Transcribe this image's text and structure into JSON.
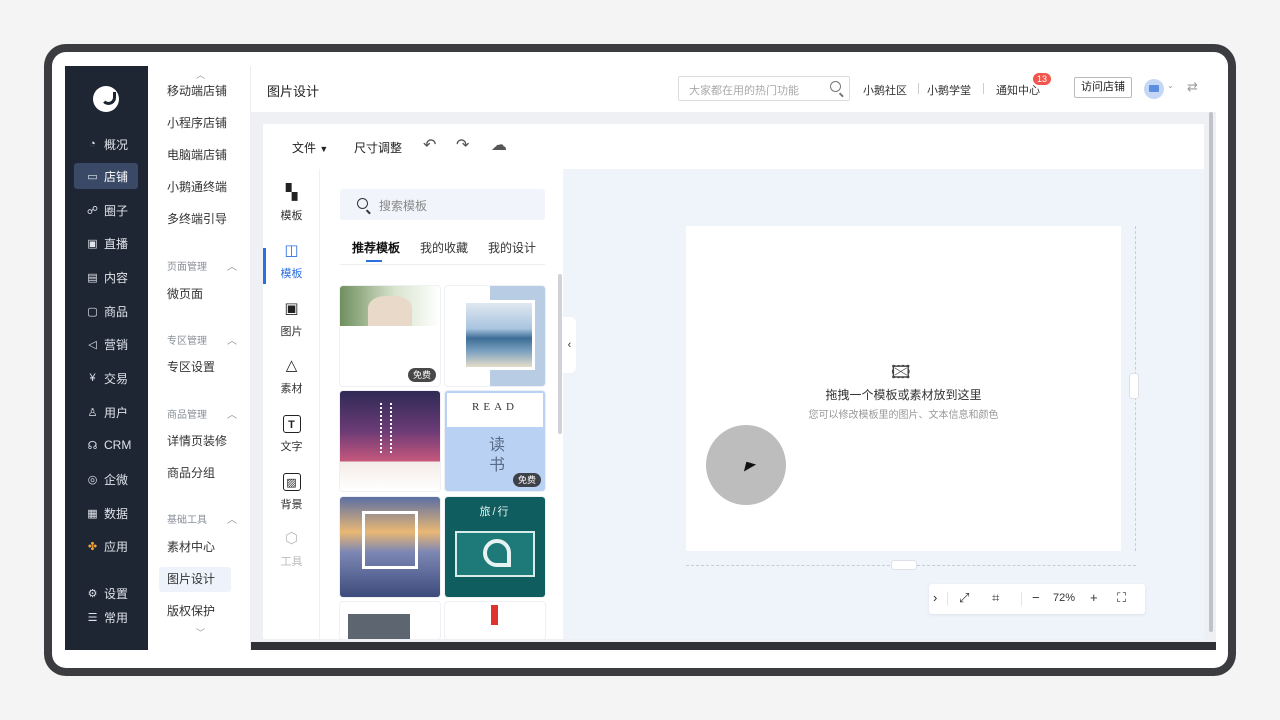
{
  "nav": {
    "items": [
      {
        "label": "概况",
        "icon": "chart-pie-icon"
      },
      {
        "label": "店铺",
        "icon": "store-icon",
        "active": true
      },
      {
        "label": "圈子",
        "icon": "users-icon"
      },
      {
        "label": "直播",
        "icon": "live-icon"
      },
      {
        "label": "内容",
        "icon": "document-icon"
      },
      {
        "label": "商品",
        "icon": "shopping-bag-icon"
      },
      {
        "label": "营销",
        "icon": "megaphone-icon"
      },
      {
        "label": "交易",
        "icon": "yen-icon"
      },
      {
        "label": "用户",
        "icon": "user-icon"
      },
      {
        "label": "CRM",
        "icon": "crm-icon"
      },
      {
        "label": "企微",
        "icon": "wecom-icon"
      },
      {
        "label": "数据",
        "icon": "dashboard-icon"
      },
      {
        "label": "应用",
        "icon": "apps-icon"
      },
      {
        "label": "设置",
        "icon": "gear-icon"
      },
      {
        "label": "常用",
        "icon": "list-icon"
      }
    ]
  },
  "submenu": {
    "items_top": [
      "移动端店铺",
      "小程序店铺",
      "电脑端店铺",
      "小鹅通终端",
      "多终端引导"
    ],
    "groups": [
      {
        "title": "页面管理",
        "items": [
          "微页面"
        ]
      },
      {
        "title": "专区管理",
        "items": [
          "专区设置"
        ]
      },
      {
        "title": "商品管理",
        "items": [
          "详情页装修",
          "商品分组"
        ]
      },
      {
        "title": "基础工具",
        "items": [
          "素材中心",
          "图片设计",
          "版权保护"
        ]
      }
    ],
    "active": "图片设计"
  },
  "header": {
    "title": "图片设计",
    "search_placeholder": "大家都在用的热门功能",
    "links": [
      "小鹅社区",
      "小鹅学堂",
      "通知中心"
    ],
    "notification_count": "13",
    "visit_store": "访问店铺"
  },
  "toolbar": {
    "file": "文件",
    "resize": "尺寸调整"
  },
  "tools": [
    {
      "label": "模板",
      "icon": "layout-icon"
    },
    {
      "label": "模板",
      "icon": "template-icon",
      "active": true
    },
    {
      "label": "图片",
      "icon": "image-icon"
    },
    {
      "label": "素材",
      "icon": "shapes-icon"
    },
    {
      "label": "文字",
      "icon": "text-icon"
    },
    {
      "label": "背景",
      "icon": "background-icon"
    },
    {
      "label": "工具",
      "icon": "box-icon",
      "disabled": true
    }
  ],
  "panel": {
    "search_placeholder": "搜索模板",
    "tabs": [
      "推荐模板",
      "我的收藏",
      "我的设计"
    ],
    "free_badge": "免费",
    "template_text": {
      "read": "READ",
      "reading": "读书",
      "travel": "旅/行"
    }
  },
  "canvas": {
    "drop_title": "拖拽一个模板或素材放到这里",
    "drop_subtitle": "您可以修改模板里的图片、文本信息和颜色"
  },
  "zoom": {
    "value": "72%"
  }
}
